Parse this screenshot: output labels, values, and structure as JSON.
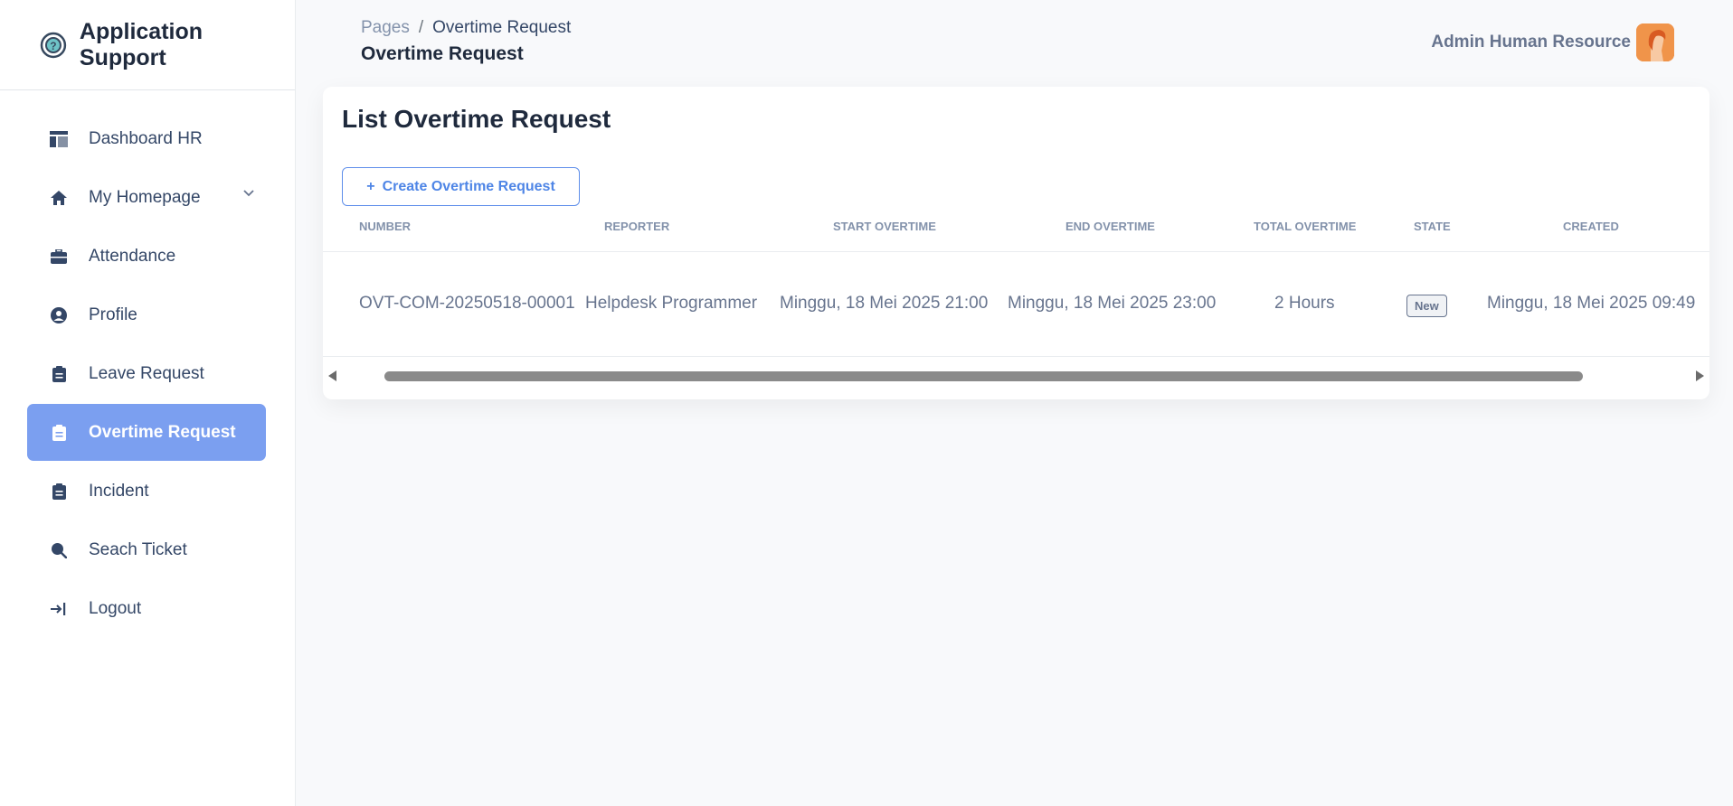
{
  "brand": {
    "name": "Application Support"
  },
  "sidebar": {
    "items": [
      {
        "label": "Dashboard HR",
        "icon": "dashboard-icon"
      },
      {
        "label": "My Homepage",
        "icon": "home-icon"
      },
      {
        "label": "Attendance",
        "icon": "briefcase-icon"
      },
      {
        "label": "Profile",
        "icon": "user-circle-icon"
      },
      {
        "label": "Leave Request",
        "icon": "clipboard-icon"
      },
      {
        "label": "Overtime Request",
        "icon": "clipboard-icon",
        "active": true
      },
      {
        "label": "Incident",
        "icon": "clipboard-icon"
      },
      {
        "label": "Seach Ticket",
        "icon": "search-icon"
      },
      {
        "label": "Logout",
        "icon": "logout-icon"
      }
    ]
  },
  "header": {
    "breadcrumb": {
      "root": "Pages",
      "separator": "/",
      "current": "Overtime Request"
    },
    "title": "Overtime Request",
    "user_name": "Admin Human Resource"
  },
  "card": {
    "title": "List Overtime Request",
    "create_button": {
      "icon": "+",
      "label": "Create Overtime Request"
    }
  },
  "table": {
    "columns": [
      "NUMBER",
      "REPORTER",
      "START OVERTIME",
      "END OVERTIME",
      "TOTAL OVERTIME",
      "STATE",
      "CREATED"
    ],
    "rows": [
      {
        "number": "OVT-COM-20250518-00001",
        "reporter": "Helpdesk Programmer",
        "start": "Minggu, 18 Mei 2025 21:00",
        "end": "Minggu, 18 Mei 2025 23:00",
        "total": "2 Hours",
        "state": "New",
        "created": "Minggu, 18 Mei 2025 09:49"
      }
    ]
  },
  "colors": {
    "accent": "#7b9ff0",
    "button": "#4e85e6",
    "text": "#344767"
  }
}
